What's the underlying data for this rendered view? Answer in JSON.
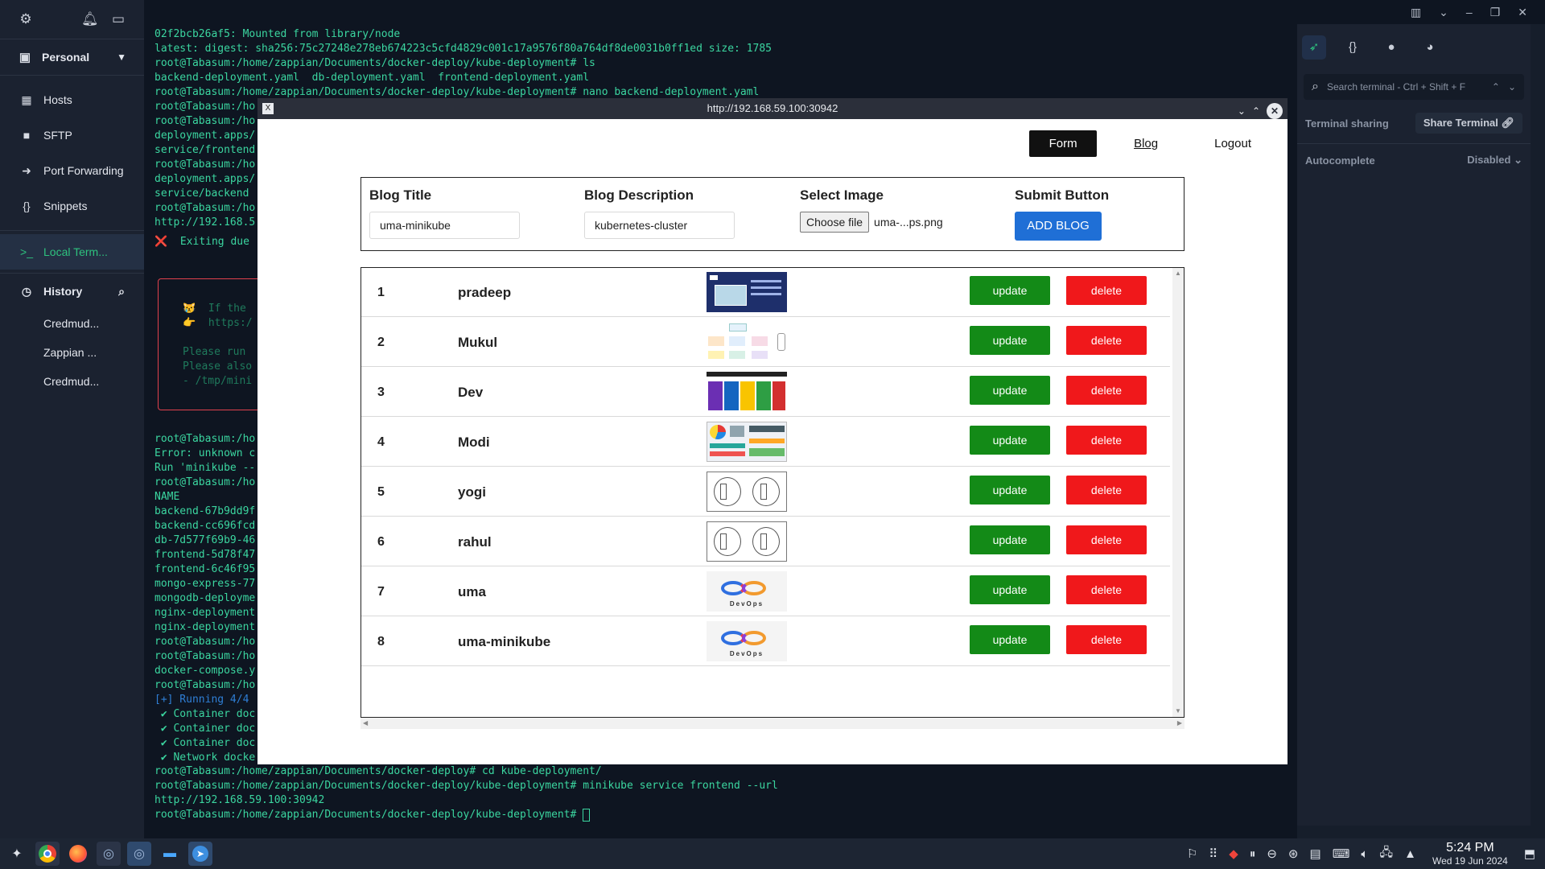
{
  "sidebar": {
    "vault_name": "Personal",
    "items": [
      {
        "label": "Hosts"
      },
      {
        "label": "SFTP"
      },
      {
        "label": "Port Forwarding"
      },
      {
        "label": "Snippets"
      }
    ],
    "active_item": "Local Term...",
    "history_label": "History",
    "history_entries": [
      "Credmud...",
      "Zappian ...",
      "Credmud..."
    ]
  },
  "terminal": {
    "lines": [
      "02f2bcb26af5: Mounted from library/node",
      "latest: digest: sha256:75c27248e278eb674223c5cfd4829c001c17a9576f80a764df8de0031b0ff1ed size: 1785",
      "root@Tabasum:/home/zappian/Documents/docker-deploy/kube-deployment# ls",
      "backend-deployment.yaml  db-deployment.yaml  frontend-deployment.yaml",
      "root@Tabasum:/home/zappian/Documents/docker-deploy/kube-deployment# nano backend-deployment.yaml",
      "root@Tabasum:/ho",
      "root@Tabasum:/ho",
      "deployment.apps/",
      "service/frontend",
      "root@Tabasum:/ho",
      "deployment.apps/",
      "service/backend",
      "root@Tabasum:/ho",
      "http://192.168.5"
    ],
    "exit_line": "❌  Exiting due",
    "box_lines": [
      "😿  If the",
      "👉  https:/",
      "",
      "Please run",
      "Please also",
      "- /tmp/mini"
    ],
    "lines2": [
      "root@Tabasum:/ho",
      "Error: unknown c",
      "Run 'minikube --",
      "root@Tabasum:/ho",
      "NAME",
      "backend-67b9dd9f",
      "backend-cc696fcd",
      "db-7d577f69b9-46",
      "frontend-5d78f47",
      "frontend-6c46f95",
      "mongo-express-77",
      "mongodb-deployme",
      "nginx-deployment",
      "nginx-deployment",
      "root@Tabasum:/ho",
      "root@Tabasum:/ho",
      "docker-compose.y",
      "root@Tabasum:/ho",
      "[+] Running 4/4",
      " ✔ Container doc",
      " ✔ Container doc",
      " ✔ Container doc",
      " ✔ Network docke"
    ],
    "bottom_lines": [
      "root@Tabasum:/home/zappian/Documents/docker-deploy# cd kube-deployment/",
      "root@Tabasum:/home/zappian/Documents/docker-deploy/kube-deployment# minikube service frontend --url",
      "http://192.168.59.100:30942",
      "root@Tabasum:/home/zappian/Documents/docker-deploy/kube-deployment# "
    ]
  },
  "right_panel": {
    "search_placeholder": "Search terminal - Ctrl + Shift + F",
    "terminal_sharing_label": "Terminal sharing",
    "share_terminal_label": "Share Terminal",
    "autocomplete_label": "Autocomplete",
    "autocomplete_value": "Disabled"
  },
  "browser": {
    "url": "http://192.168.59.100:30942",
    "nav": {
      "form": "Form",
      "blog": "Blog",
      "logout": "Logout"
    },
    "form": {
      "title_label": "Blog Title",
      "title_value": "uma-minikube",
      "desc_label": "Blog Description",
      "desc_value": "kubernetes-cluster",
      "image_label": "Select Image",
      "choose_file": "Choose file",
      "file_name": "uma-...ps.png",
      "submit_label": "Submit Button",
      "add_button": "ADD BLOG"
    },
    "blogs": [
      {
        "num": "1",
        "name": "pradeep",
        "thumb": "slide"
      },
      {
        "num": "2",
        "name": "Mukul",
        "thumb": "diagram"
      },
      {
        "num": "3",
        "name": "Dev",
        "thumb": "infographic"
      },
      {
        "num": "4",
        "name": "Modi",
        "thumb": "dashboard"
      },
      {
        "num": "5",
        "name": "yogi",
        "thumb": "sketch"
      },
      {
        "num": "6",
        "name": "rahul",
        "thumb": "sketch"
      },
      {
        "num": "7",
        "name": "uma",
        "thumb": "devops"
      },
      {
        "num": "8",
        "name": "uma-minikube",
        "thumb": "devops"
      }
    ],
    "update_label": "update",
    "delete_label": "delete",
    "devops_text": "DevOps"
  },
  "taskbar": {
    "time": "5:24 PM",
    "date": "Wed 19 Jun 2024"
  }
}
